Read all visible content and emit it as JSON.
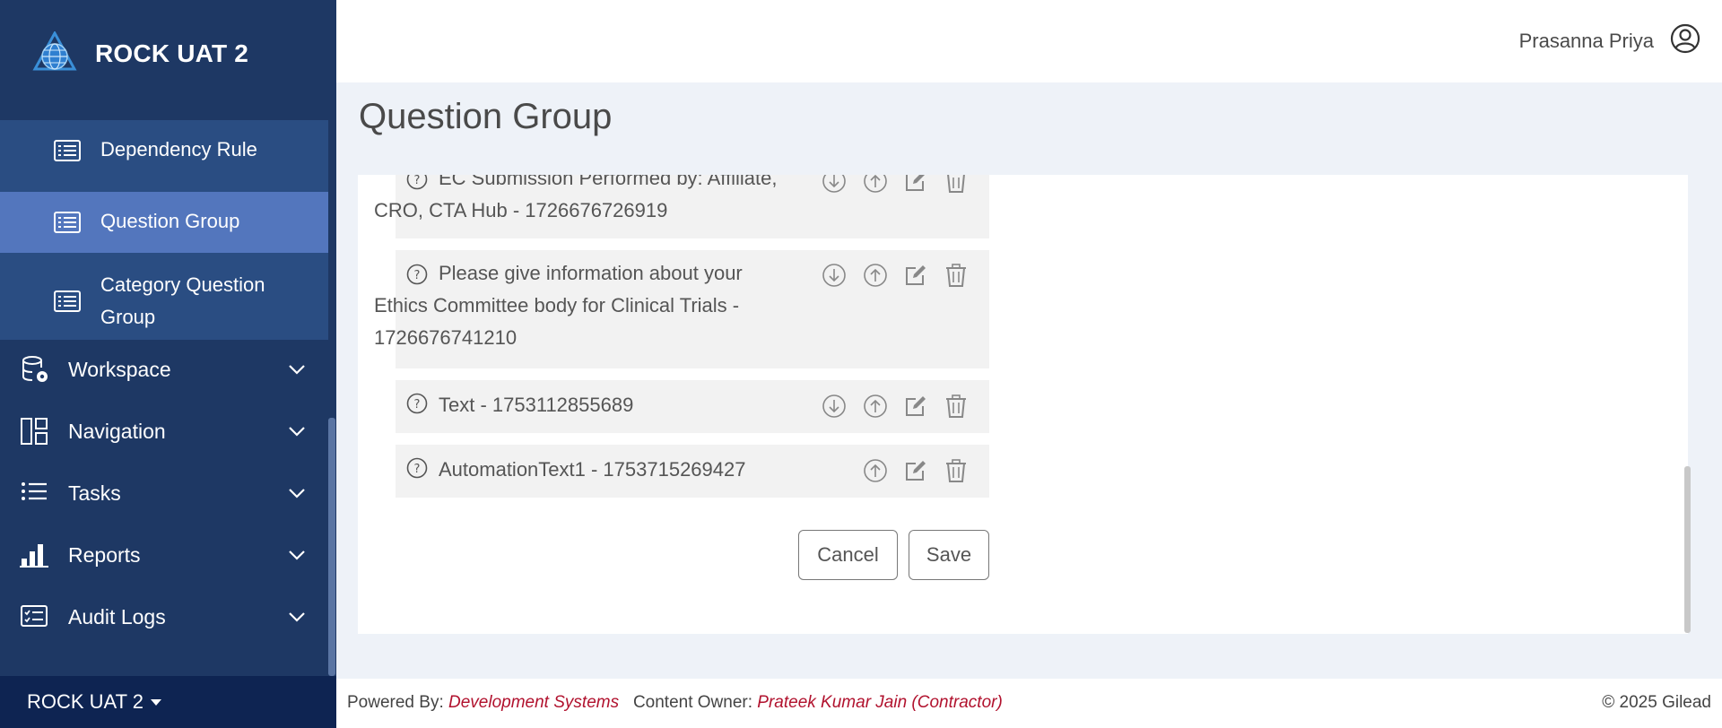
{
  "app": {
    "name": "ROCK UAT 2",
    "env_switcher": "ROCK UAT 2"
  },
  "sidebar": {
    "sub_items": [
      {
        "label": "Dependency Rule",
        "icon": "list-icon",
        "active": false
      },
      {
        "label": "Question Group",
        "icon": "list-icon",
        "active": true
      },
      {
        "label": "Category Question Group",
        "icon": "list-icon",
        "active": false
      }
    ],
    "menu_items": [
      {
        "label": "Workspace",
        "icon": "database-gear-icon"
      },
      {
        "label": "Navigation",
        "icon": "layout-icon"
      },
      {
        "label": "Tasks",
        "icon": "bullet-list-icon"
      },
      {
        "label": "Reports",
        "icon": "bar-chart-icon"
      },
      {
        "label": "Audit Logs",
        "icon": "checklist-icon"
      }
    ]
  },
  "header": {
    "user_name": "Prasanna Priya"
  },
  "page": {
    "title": "Question Group"
  },
  "questions": [
    {
      "line1": "EC Submission Performed by: Affiliate,",
      "line2": "CRO, CTA Hub - 1726676726919"
    },
    {
      "line1": "Please give information about your",
      "line2": "Ethics Committee body for Clinical Trials -",
      "line3": "1726676741210"
    },
    {
      "line1": "Text - 1753112855689"
    },
    {
      "line1": "AutomationText1 - 1753715269427"
    }
  ],
  "actions": {
    "cancel": "Cancel",
    "save": "Save"
  },
  "footer": {
    "powered_by_label": "Powered By:",
    "powered_by_value": "Development Systems",
    "owner_label": "Content Owner:",
    "owner_value": "Prateek Kumar Jain (Contractor)",
    "copyright": "© 2025 Gilead"
  },
  "colors": {
    "sidebar_bg": "#1e3864",
    "submenu_bg": "#2a4d82",
    "active_bg": "#5376bd",
    "footer_accent": "#b1122e"
  }
}
